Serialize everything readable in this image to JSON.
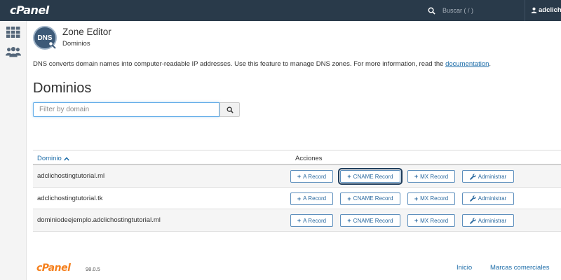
{
  "header": {
    "logo": "cPanel",
    "search_placeholder": "Buscar ( / )",
    "user": "adclicho"
  },
  "sidebar": {
    "items": [
      {
        "icon": "grid-icon"
      },
      {
        "icon": "users-icon"
      }
    ]
  },
  "page": {
    "icon_text": "DNS",
    "title": "Zone Editor",
    "subtitle": "Dominios",
    "description": "DNS converts domain names into computer-readable IP addresses. Use this feature to manage DNS zones. For more information, read the",
    "doc_link": "documentation",
    "doc_suffix": ".",
    "heading": "Dominios",
    "filter_placeholder": "Filter by domain"
  },
  "table": {
    "col_domain": "Dominio",
    "col_actions": "Acciones",
    "buttons": {
      "a_record": "A Record",
      "cname_record": "CNAME Record",
      "mx_record": "MX Record",
      "manage": "Administrar"
    },
    "rows": [
      {
        "domain": "adclichostingtutorial.ml"
      },
      {
        "domain": "adclichostingtutorial.tk"
      },
      {
        "domain": "dominiodeejemplo.adclichostingtutorial.ml"
      }
    ]
  },
  "footer": {
    "logo": "cPanel",
    "version": "98.0.5",
    "links": [
      "Inicio",
      "Marcas comerciales"
    ]
  },
  "colors": {
    "topbar": "#293a4a",
    "link": "#1c6ca8",
    "brand_orange": "#f5811f",
    "button_border": "#5d8fbd"
  }
}
